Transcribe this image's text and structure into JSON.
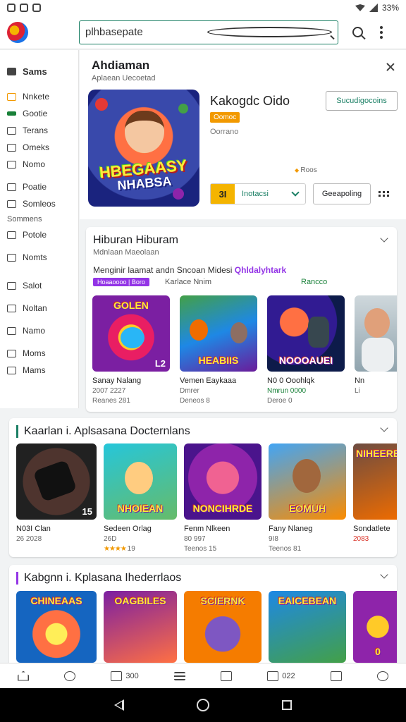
{
  "status": {
    "right_text": "33%"
  },
  "search": {
    "value": "plhbasepate"
  },
  "sidebar": {
    "top": "Sams",
    "items": [
      {
        "label": "Nnkete",
        "style": "orange"
      },
      {
        "label": "Gootie",
        "style": "green"
      },
      {
        "label": "Terans",
        "style": ""
      },
      {
        "label": "Omeks",
        "style": ""
      },
      {
        "label": "Nomo",
        "style": ""
      }
    ],
    "items2": [
      {
        "label": "Poatie"
      },
      {
        "label": "Somleos"
      }
    ],
    "section_head": "Sommens",
    "items3": [
      {
        "label": "Potole"
      },
      {
        "label": "Nomts"
      }
    ],
    "items4": [
      {
        "label": "Salot"
      },
      {
        "label": "Noltan"
      },
      {
        "label": "Namo"
      },
      {
        "label": "Moms"
      },
      {
        "label": "Mams"
      }
    ]
  },
  "hero": {
    "title": "Ahdiaman",
    "subtitle": "Aplaean Uecoetad",
    "art_text_1": "HBEGAASY",
    "art_text_2": "NHABSA",
    "app_name": "Kakogdc Oido",
    "tag": "Oomoc",
    "dev": "Oorrano",
    "rating": "Roos",
    "subscribe_label": "Sucudigocoins",
    "install_num": "3I",
    "install_label": "Inotacsi",
    "share_label": "Geeapoling"
  },
  "section1": {
    "title": "Hiburan Hiburam",
    "subtitle": "Mdnlaan Maeolaan",
    "desc_plain": "Menginir laamat andn Sncoan Midesi ",
    "desc_highlight": "Qhldalyhtark",
    "chip": "Hoaaoooo | Boro",
    "chip_text": "Karlace Nnim",
    "chip_green": "Rancco",
    "tiles": [
      {
        "art": "GOLEN",
        "corner": "L2",
        "name": "Sanay Nalang",
        "meta1": "2007 2227",
        "meta2": "Reanes 281"
      },
      {
        "art": "HEABIIS",
        "corner": "",
        "name": "Vemen Eaykaaa",
        "meta1": "Dmrer",
        "meta2": "Deneos 8"
      },
      {
        "art": "NOOOAUEI",
        "corner": "",
        "name": "N0 0 Ooohlqk",
        "meta1": "Nmrun 0000",
        "meta2": "Deroe 0"
      },
      {
        "art": "",
        "corner": "",
        "name": "Nn",
        "meta1": "Li",
        "meta2": ""
      }
    ]
  },
  "section2": {
    "title": "Kaarlan i. Aplsasana Docternlans",
    "tiles": [
      {
        "art": "",
        "corner": "15",
        "name": "N03I Clan",
        "meta1": "26 2028",
        "meta2": ""
      },
      {
        "art": "NHOIEAN",
        "corner": "",
        "name": "Sedeen Orlag",
        "meta1": "26D",
        "meta2": "19"
      },
      {
        "art": "NONCIHRDE",
        "corner": "",
        "name": "Fenm Nlkeen",
        "meta1": "80 997",
        "meta2": "Teenos 15"
      },
      {
        "art": "EOMUH",
        "corner": "",
        "name": "Fany Nlaneg",
        "meta1": "9I8",
        "meta2": "Teenos 81"
      },
      {
        "art": "NIHEERE",
        "corner": "",
        "name": "Sondatlete",
        "meta1": "2083",
        "meta2": ""
      }
    ]
  },
  "section3": {
    "title": "Kabgnn i. Kplasana Ihederrlaos",
    "tiles": [
      {
        "art": "CHINEAAS"
      },
      {
        "art": "OAGBILES"
      },
      {
        "art": "SCIERNK"
      },
      {
        "art": "EAICEBEAN"
      },
      {
        "art": "0"
      }
    ]
  },
  "bottomnav": {
    "n1": "300",
    "n2": "022"
  }
}
